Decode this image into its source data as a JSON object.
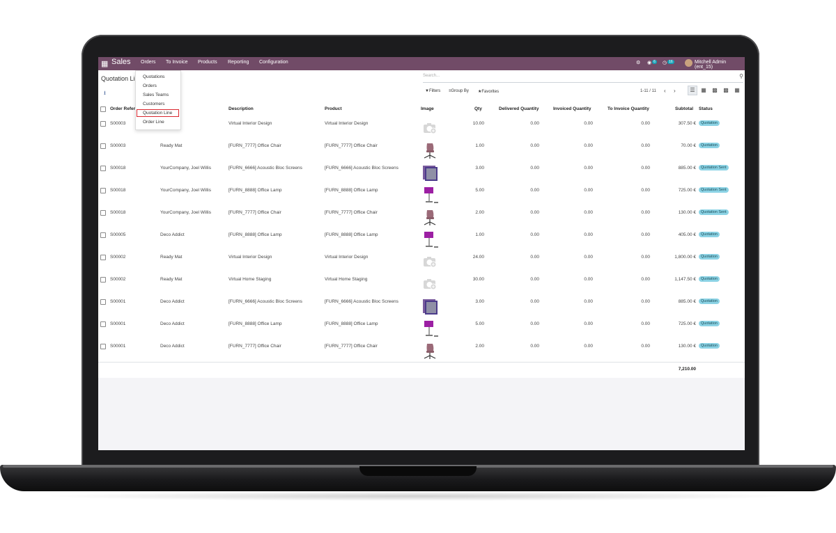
{
  "navbar": {
    "brand": "Sales",
    "menu": [
      "Orders",
      "To Invoice",
      "Products",
      "Reporting",
      "Configuration"
    ],
    "chat_count": "6",
    "activity_count": "16",
    "user": "Mitchell Admin (ent_15)",
    "apps_icon": "grid-icon",
    "color": "#714b67"
  },
  "page": {
    "title": "Quotation Li",
    "search_placeholder": "Search...",
    "filters_label": "Filters",
    "group_by_label": "Group By",
    "favorites_label": "Favorites",
    "pager": "1-11 / 11",
    "views": [
      "list-view-icon",
      "kanban-view-icon",
      "pivot-view-icon",
      "graph-view-icon",
      "calendar-view-icon"
    ],
    "active_view": "list-view-icon"
  },
  "orders_menu": {
    "items": [
      "Quotations",
      "Orders",
      "Sales Teams",
      "Customers",
      "Quotation Line",
      "Order Line"
    ],
    "highlighted": "Quotation Line"
  },
  "table": {
    "headers": {
      "order_ref": "Order Refere",
      "customer": "",
      "description": "Description",
      "product": "Product",
      "image": "Image",
      "qty": "Qty",
      "delivered": "Delivered Quantity",
      "invoiced": "Invoiced Quantity",
      "to_invoice": "To Invoice Quantity",
      "subtotal": "Subtotal",
      "status": "Status"
    },
    "rows": [
      {
        "ref": "S00003",
        "customer": "t",
        "description": "Virtual Interior Design",
        "product": "Virtual Interior Design",
        "image": "placeholder",
        "qty": "10.00",
        "delivered": "0.00",
        "invoiced": "0.00",
        "to_invoice": "0.00",
        "subtotal": "307.50 €",
        "status": "Quotation"
      },
      {
        "ref": "S00003",
        "customer": "Ready Mat",
        "description": "[FURN_7777] Office Chair",
        "product": "[FURN_7777] Office Chair",
        "image": "chair",
        "qty": "1.00",
        "delivered": "0.00",
        "invoiced": "0.00",
        "to_invoice": "0.00",
        "subtotal": "70.00 €",
        "status": "Quotation"
      },
      {
        "ref": "S00018",
        "customer": "YourCompany, Joel Willis",
        "description": "[FURN_6666] Acoustic Bloc Screens",
        "product": "[FURN_6666] Acoustic Bloc Screens",
        "image": "screens",
        "qty": "3.00",
        "delivered": "0.00",
        "invoiced": "0.00",
        "to_invoice": "0.00",
        "subtotal": "885.00 €",
        "status": "Quotation Sent"
      },
      {
        "ref": "S00018",
        "customer": "YourCompany, Joel Willis",
        "description": "[FURN_8888] Office Lamp",
        "product": "[FURN_8888] Office Lamp",
        "image": "lamp",
        "qty": "5.00",
        "delivered": "0.00",
        "invoiced": "0.00",
        "to_invoice": "0.00",
        "subtotal": "725.00 €",
        "status": "Quotation Sent"
      },
      {
        "ref": "S00018",
        "customer": "YourCompany, Joel Willis",
        "description": "[FURN_7777] Office Chair",
        "product": "[FURN_7777] Office Chair",
        "image": "chair",
        "qty": "2.00",
        "delivered": "0.00",
        "invoiced": "0.00",
        "to_invoice": "0.00",
        "subtotal": "130.00 €",
        "status": "Quotation Sent"
      },
      {
        "ref": "S00005",
        "customer": "Deco Addict",
        "description": "[FURN_8888] Office Lamp",
        "product": "[FURN_8888] Office Lamp",
        "image": "lamp",
        "qty": "1.00",
        "delivered": "0.00",
        "invoiced": "0.00",
        "to_invoice": "0.00",
        "subtotal": "405.00 €",
        "status": "Quotation"
      },
      {
        "ref": "S00002",
        "customer": "Ready Mat",
        "description": "Virtual Interior Design",
        "product": "Virtual Interior Design",
        "image": "placeholder",
        "qty": "24.00",
        "delivered": "0.00",
        "invoiced": "0.00",
        "to_invoice": "0.00",
        "subtotal": "1,800.00 €",
        "status": "Quotation"
      },
      {
        "ref": "S00002",
        "customer": "Ready Mat",
        "description": "Virtual Home Staging",
        "product": "Virtual Home Staging",
        "image": "placeholder",
        "qty": "30.00",
        "delivered": "0.00",
        "invoiced": "0.00",
        "to_invoice": "0.00",
        "subtotal": "1,147.50 €",
        "status": "Quotation"
      },
      {
        "ref": "S00001",
        "customer": "Deco Addict",
        "description": "[FURN_6666] Acoustic Bloc Screens",
        "product": "[FURN_6666] Acoustic Bloc Screens",
        "image": "screens",
        "qty": "3.00",
        "delivered": "0.00",
        "invoiced": "0.00",
        "to_invoice": "0.00",
        "subtotal": "885.00 €",
        "status": "Quotation"
      },
      {
        "ref": "S00001",
        "customer": "Deco Addict",
        "description": "[FURN_8888] Office Lamp",
        "product": "[FURN_8888] Office Lamp",
        "image": "lamp",
        "qty": "5.00",
        "delivered": "0.00",
        "invoiced": "0.00",
        "to_invoice": "0.00",
        "subtotal": "725.00 €",
        "status": "Quotation"
      },
      {
        "ref": "S00001",
        "customer": "Deco Addict",
        "description": "[FURN_7777] Office Chair",
        "product": "[FURN_7777] Office Chair",
        "image": "chair",
        "qty": "2.00",
        "delivered": "0.00",
        "invoiced": "0.00",
        "to_invoice": "0.00",
        "subtotal": "130.00 €",
        "status": "Quotation"
      }
    ],
    "total": "7,210.00"
  }
}
